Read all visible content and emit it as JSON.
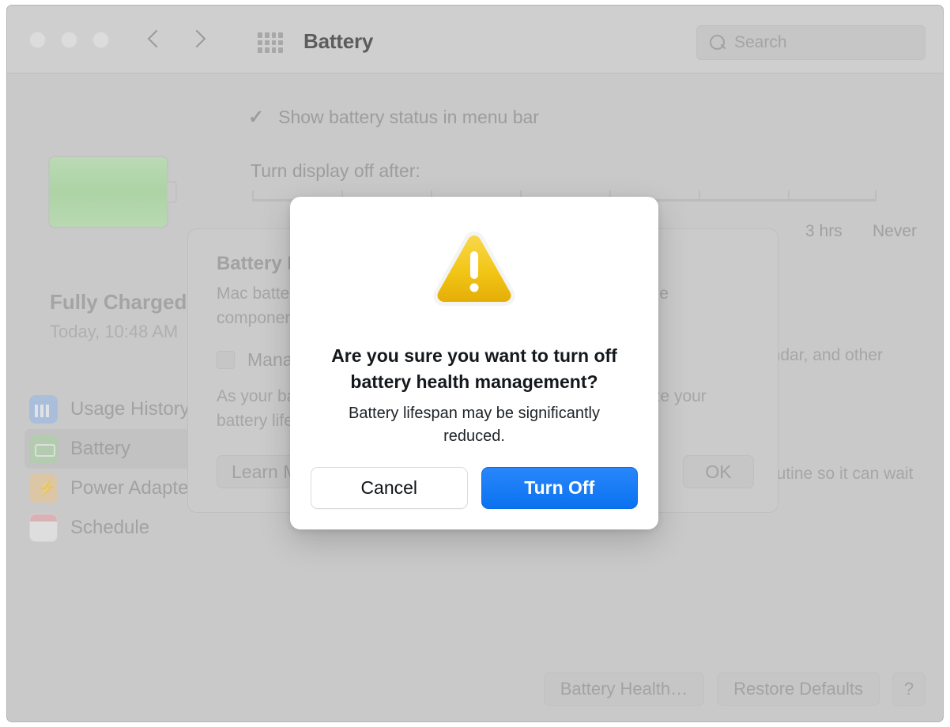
{
  "window": {
    "title": "Battery",
    "search_placeholder": "Search"
  },
  "preferences": {
    "show_battery_status_label": "Show battery status in menu bar",
    "show_battery_status_checked": true,
    "turn_display_off_label": "Turn display off after:",
    "slider_labels": [
      "3 hrs",
      "Never"
    ],
    "charge_status": "Fully Charged",
    "charge_time": "Today, 10:48 AM"
  },
  "sidebar": {
    "items": [
      {
        "label": "Usage History",
        "icon": "usage-history-icon",
        "selected": false
      },
      {
        "label": "Battery",
        "icon": "battery-icon",
        "selected": true
      },
      {
        "label": "Power Adapter",
        "icon": "power-adapter-icon",
        "selected": false
      },
      {
        "label": "Schedule",
        "icon": "schedule-icon",
        "selected": false
      }
    ]
  },
  "background_text": {
    "line_1": "endar, and other",
    "line_2": "routine so it can wait"
  },
  "sheet": {
    "title": "Battery Health",
    "body": "Mac batteries, like all rechargeable batteries, are consumable components that become less effective as they age.",
    "checkbox_label": "Manage battery longevity",
    "checkbox_checked": false,
    "note": "As your battery health decreases, this feature helps maximize your battery lifespan.",
    "learn_more_label": "Learn More…",
    "ok_label": "OK"
  },
  "bottom_buttons": {
    "battery_health": "Battery Health…",
    "restore_defaults": "Restore Defaults",
    "help": "?"
  },
  "modal": {
    "icon": "warning-triangle-icon",
    "title": "Are you sure you want to turn off battery health management?",
    "body": "Battery lifespan may be significantly reduced.",
    "cancel_label": "Cancel",
    "confirm_label": "Turn Off",
    "accent_color": "#0a72f0",
    "warning_color": "#f0c419"
  }
}
